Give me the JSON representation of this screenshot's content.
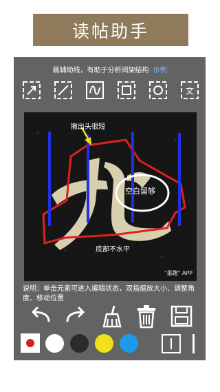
{
  "banner": {
    "title": "读帖助手"
  },
  "hint": {
    "text": "画辅助线，有助于分析间架结构",
    "link": "示例"
  },
  "tools": [
    {
      "name": "arrow-tool-icon"
    },
    {
      "name": "line-tool-icon"
    },
    {
      "name": "curve-tool-icon"
    },
    {
      "name": "rectangle-tool-icon"
    },
    {
      "name": "ellipse-tool-icon"
    },
    {
      "name": "text-tool-icon",
      "glyph": "文"
    }
  ],
  "canvas": {
    "annotation_top": "撇出头很短",
    "annotation_circle": "空白留够",
    "annotation_bottom": "底部不水平",
    "watermark": "\"墨趣\" APP"
  },
  "note": {
    "text": "说明：单击元素可进入编辑状态，双指缩放大小、调整角度、移动位置"
  },
  "actions": [
    "undo",
    "redo",
    "clear",
    "delete",
    "save"
  ],
  "palette": {
    "selected": "#d0261d",
    "colors": [
      "#ffffff",
      "#2b2b2b",
      "#f2e01b",
      "#1e9be6"
    ]
  },
  "colors": {
    "banner": "#8f7a5b",
    "panel": "#636363",
    "annotation_blue": "#1f31e0",
    "annotation_red": "#e02020"
  }
}
